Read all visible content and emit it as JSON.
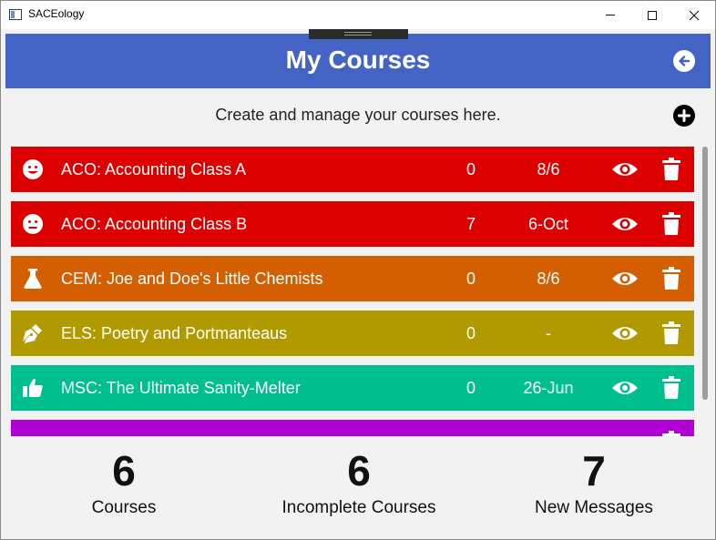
{
  "window": {
    "title": "SACEology"
  },
  "header": {
    "title": "My Courses"
  },
  "subtitle": "Create and manage your courses here.",
  "colors": {
    "header": "#4364c4",
    "red": "#dd0000",
    "orange": "#d35f00",
    "olive": "#b19a00",
    "teal": "#00bf8f",
    "purple": "#b000d6"
  },
  "courses": [
    {
      "icon": "smile-icon",
      "name": "ACO: Accounting Class A",
      "count": "0",
      "date": "8/6",
      "color": "#dd0000"
    },
    {
      "icon": "neutral-face-icon",
      "name": "ACO: Accounting Class B",
      "count": "7",
      "date": "6-Oct",
      "color": "#dd0000"
    },
    {
      "icon": "flask-icon",
      "name": "CEM: Joe and Doe's Little Chemists",
      "count": "0",
      "date": "8/6",
      "color": "#d35f00"
    },
    {
      "icon": "pen-nib-icon",
      "name": "ELS: Poetry and Portmanteaus",
      "count": "0",
      "date": "-",
      "color": "#b19a00"
    },
    {
      "icon": "thumbs-up-icon",
      "name": "MSC: The Ultimate Sanity-Melter",
      "count": "0",
      "date": "26-Jun",
      "color": "#00bf8f"
    },
    {
      "icon": "",
      "name": "",
      "count": "",
      "date": "",
      "color": "#b000d6"
    }
  ],
  "stats": [
    {
      "value": "6",
      "label": "Courses"
    },
    {
      "value": "6",
      "label": "Incomplete Courses"
    },
    {
      "value": "7",
      "label": "New Messages"
    }
  ]
}
